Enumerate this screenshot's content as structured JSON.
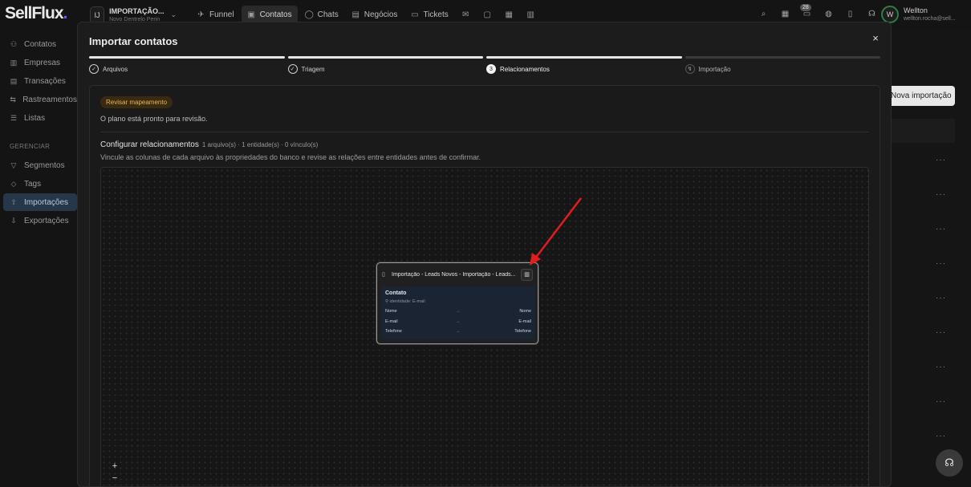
{
  "app": {
    "logo": "SellFlux",
    "logo_dot": "."
  },
  "workspace": {
    "initials": "IJ",
    "name": "IMPORTAÇÃO...",
    "subtitle": "Novo Dentrelo Perin"
  },
  "nav": [
    {
      "label": "Funnel",
      "icon": "rocket-icon",
      "glyph": "✈"
    },
    {
      "label": "Contatos",
      "icon": "contacts-icon",
      "glyph": "▣",
      "active": true
    },
    {
      "label": "Chats",
      "icon": "chat-icon",
      "glyph": "◯"
    },
    {
      "label": "Negócios",
      "icon": "briefcase-icon",
      "glyph": "▤"
    },
    {
      "label": "Tickets",
      "icon": "ticket-icon",
      "glyph": "▭"
    }
  ],
  "nav_extra_icons": [
    "mail-icon",
    "message-icon",
    "calendar-icon",
    "chart-icon"
  ],
  "header_icons": [
    "search-icon",
    "apps-icon",
    "inbox-icon",
    "globe-icon",
    "book-icon",
    "headset-icon"
  ],
  "notifications_count": "28",
  "user": {
    "initial": "W",
    "name": "Wellton",
    "email": "wellton.rocha@sell..."
  },
  "sidebar": {
    "items": [
      {
        "label": "Contatos",
        "icon": "users-icon",
        "glyph": "⚇"
      },
      {
        "label": "Empresas",
        "icon": "building-icon",
        "glyph": "▥"
      },
      {
        "label": "Transações",
        "icon": "transactions-icon",
        "glyph": "▤"
      },
      {
        "label": "Rastreamentos",
        "icon": "tracking-icon",
        "glyph": "⇆"
      },
      {
        "label": "Listas",
        "icon": "list-icon",
        "glyph": "☰"
      }
    ],
    "section": "GERENCIAR",
    "manage_items": [
      {
        "label": "Segmentos",
        "icon": "filter-icon",
        "glyph": "▽"
      },
      {
        "label": "Tags",
        "icon": "tag-icon",
        "glyph": "◇"
      },
      {
        "label": "Importações",
        "icon": "upload-icon",
        "glyph": "⇧",
        "active": true
      },
      {
        "label": "Exportações",
        "icon": "download-icon",
        "glyph": "⇩"
      }
    ]
  },
  "background": {
    "new_import_button": "Nova importação"
  },
  "modal": {
    "title": "Importar contatos",
    "close": "×",
    "steps": [
      {
        "label": "Arquivos",
        "marker": "✓",
        "state": "done"
      },
      {
        "label": "Triagem",
        "marker": "✓",
        "state": "done"
      },
      {
        "label": "Relacionamentos",
        "marker": "3",
        "state": "current"
      },
      {
        "label": "Importação",
        "marker": "↯",
        "state": "todo"
      }
    ],
    "review_badge": "Revisar mapeamento",
    "plan_status": "O plano está pronto para revisão.",
    "configure": {
      "title": "Configurar relacionamentos",
      "meta": "1 arquivo(s) · 1 entidade(s) · 0 vínculo(s)",
      "description": "Vincule as colunas de cada arquivo às propriedades do banco e revise as relações entre entidades antes de confirmar."
    },
    "node": {
      "file_title": "Importação - Leads Novos - Importação - Leads...",
      "entity": "Contato",
      "identity": "⚲ identidade: E-mail",
      "mappings": [
        {
          "source": "Nome",
          "arrow": "→",
          "target": "Nome"
        },
        {
          "source": "E-mail",
          "arrow": "→",
          "target": "E-mail"
        },
        {
          "source": "Telefone",
          "arrow": "→",
          "target": "Telefone"
        }
      ]
    },
    "zoom": {
      "in": "+",
      "out": "−"
    }
  },
  "annotation_color": "#e11d1d"
}
